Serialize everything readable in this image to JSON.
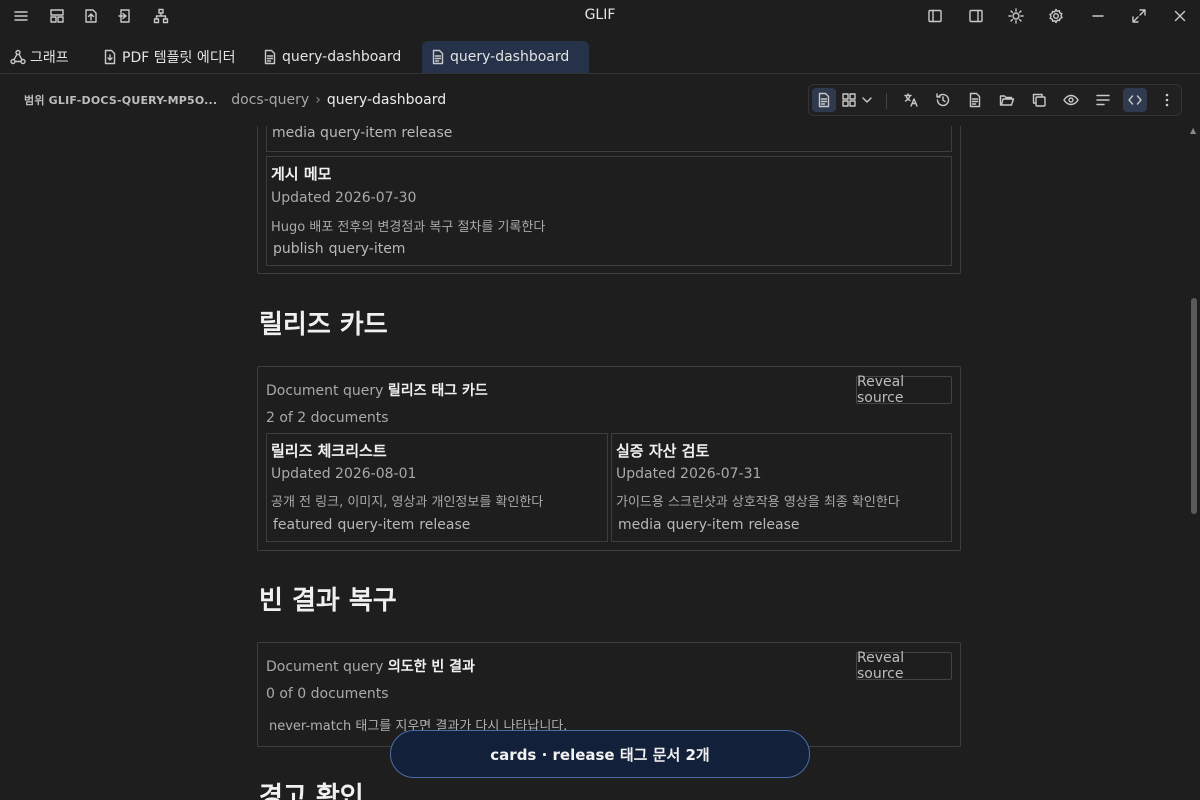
{
  "app": {
    "title": "GLIF"
  },
  "titlebar_icons": [
    "menu-icon",
    "layout-icon",
    "upload-file-icon",
    "export-icon",
    "sitemap-icon",
    "sidebar-left-icon",
    "sidebar-right-icon",
    "sun-icon",
    "gear-icon",
    "minimize-icon",
    "maximize-icon",
    "close-icon"
  ],
  "tabs": [
    {
      "label": "그래프",
      "icon": "graph-icon"
    },
    {
      "label": "PDF 템플릿 에디터",
      "icon": "pdf-file-icon"
    },
    {
      "label": "query-dashboard",
      "icon": "document-icon"
    },
    {
      "label": "query-dashboard",
      "icon": "document-icon",
      "active": true
    }
  ],
  "breadcrumb": {
    "scope": "범위 GLIF-DOCS-QUERY-MP5O...",
    "folder": "docs-query",
    "sep": "›",
    "current": "query-dashboard"
  },
  "toolbar_icons": [
    "document-view-icon",
    "grid-view-icon",
    "chevron-down-icon",
    "translate-icon",
    "history-icon",
    "file-text-icon",
    "folder-open-icon",
    "copy-icon",
    "eye-icon",
    "align-icon",
    "code-icon",
    "more-vertical-icon"
  ],
  "top_section": {
    "partial_tags": "media  query-item  release",
    "card": {
      "title": "게시 메모",
      "updated": "Updated 2026-07-30",
      "desc": "Hugo 배포 전후의 변경점과 복구 절차를 기록한다",
      "tags": [
        "publish",
        "query-item"
      ]
    }
  },
  "release_section": {
    "heading": "릴리즈 카드",
    "query_prefix": "Document query",
    "query_title": "릴리즈 태그 카드",
    "reveal": "Reveal source",
    "count": "2 of 2 documents",
    "cards": [
      {
        "title": "릴리즈 체크리스트",
        "updated": "Updated 2026-08-01",
        "desc": "공개 전 링크, 이미지, 영상과 개인정보를 확인한다",
        "tags": [
          "featured",
          "query-item",
          "release"
        ]
      },
      {
        "title": "실증 자산 검토",
        "updated": "Updated 2026-07-31",
        "desc": "가이드용 스크린샷과 상호작용 영상을 최종 확인한다",
        "tags": [
          "media",
          "query-item",
          "release"
        ]
      }
    ]
  },
  "empty_section": {
    "heading": "빈 결과 복구",
    "query_prefix": "Document query",
    "query_title": "의도한 빈 결과",
    "reveal": "Reveal source",
    "count": "0 of 0 documents",
    "message": "never-match 태그를 지우면 결과가 다시 나타납니다."
  },
  "next_heading": "경고 확인",
  "toast": {
    "text": "cards · release 태그 문서 2개"
  }
}
